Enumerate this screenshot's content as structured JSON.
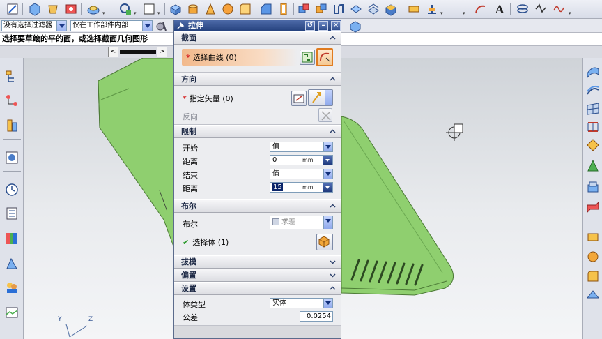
{
  "toolbar": {
    "icons": [
      "sketch-icon",
      "extrude-icon",
      "revolve-icon",
      "hole-icon",
      "boss-icon",
      "datum-plane-icon",
      "datum-csys-icon",
      "rectangle-icon",
      "block-icon",
      "cylinder-icon",
      "cone-icon",
      "sphere-icon",
      "edge-blend-icon",
      "chamfer-icon",
      "shell-icon",
      "draft-icon",
      "unite-icon",
      "subtract-icon",
      "intersect-icon",
      "trim-body-icon",
      "offset-face-icon",
      "move-face-icon",
      "curve-arc-icon",
      "text-icon",
      "spline-icon",
      "helix-icon"
    ]
  },
  "filter_row": {
    "type_filter": "没有选择过滤器",
    "scope_filter": "仅在工作部件内部"
  },
  "cue_line": {
    "text": "选择要草绘的平的面，或选择截面几何图形"
  },
  "dialog": {
    "title": "拉伸",
    "section": {
      "label": "截面",
      "select_curve": "选择曲线 (0)"
    },
    "direction": {
      "label": "方向",
      "specify_vector": "指定矢量 (0)",
      "reverse": "反向"
    },
    "limits": {
      "label": "限制",
      "start_label": "开始",
      "start_value": "值",
      "start_distance_label": "距离",
      "start_distance": "0",
      "start_unit": "mm",
      "end_label": "结束",
      "end_value": "值",
      "end_distance_label": "距离",
      "end_distance": "15",
      "end_unit": "mm"
    },
    "boolean": {
      "label": "布尔",
      "boolean_label": "布尔",
      "boolean_value": "求差",
      "select_body": "选择体 (1)"
    },
    "draft": {
      "label": "拔模"
    },
    "offset": {
      "label": "偏置"
    },
    "settings": {
      "label": "设置",
      "body_type_label": "体类型",
      "body_type_value": "实体",
      "tolerance_label": "公差",
      "tolerance_value": "0.0254"
    }
  },
  "csys": {
    "y_label": "Y",
    "z_label": "Z"
  },
  "colors": {
    "model_green": "#8fcf6f",
    "dialog_header": "#2f4c8a",
    "orange_highlight": "#f2b98c"
  }
}
